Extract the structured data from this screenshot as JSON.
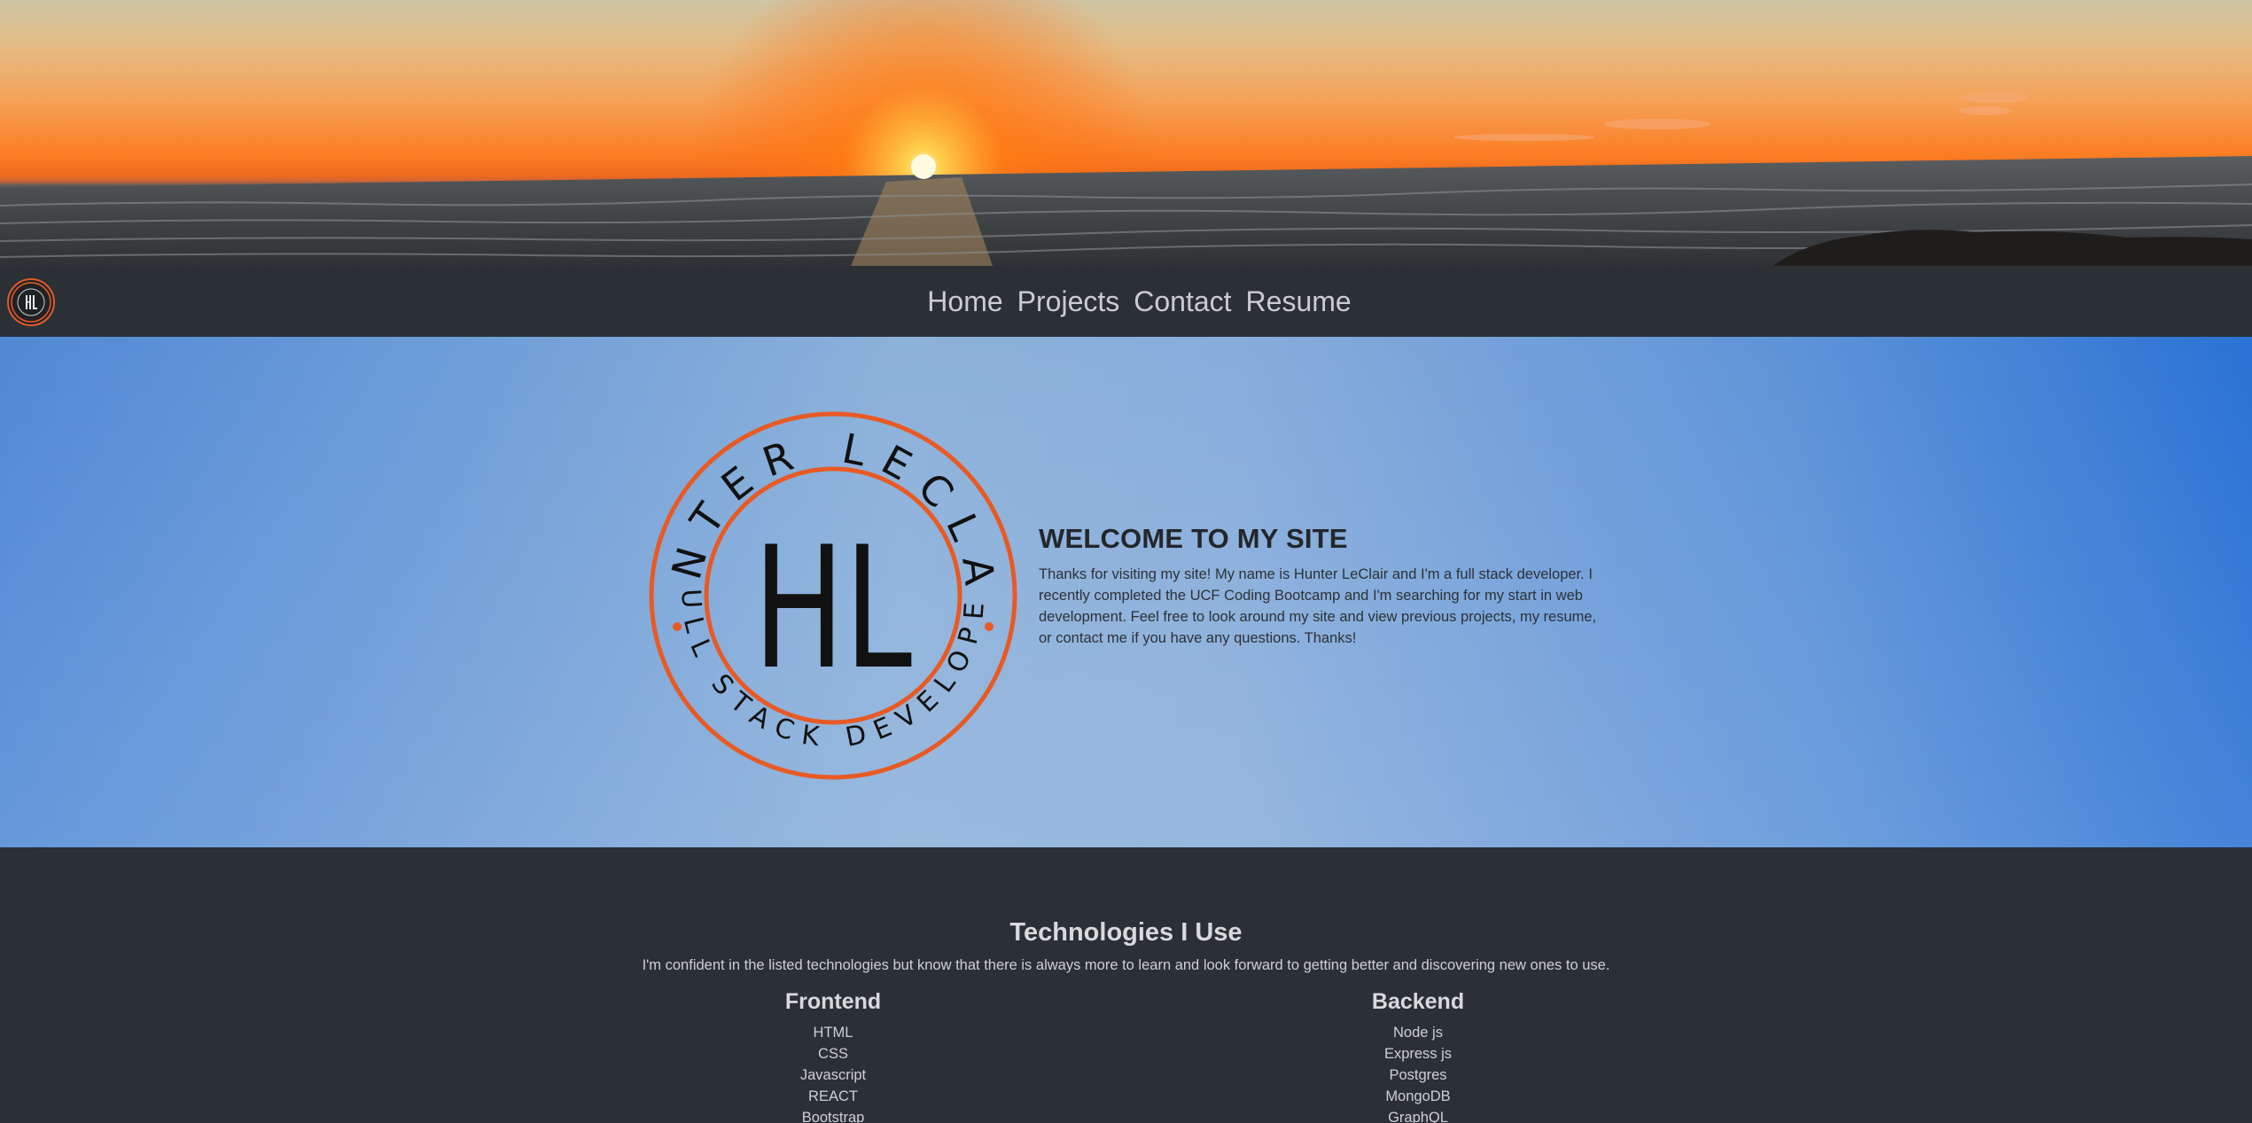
{
  "banner": {
    "alt": "Sunset over the ocean"
  },
  "nav": {
    "logo_icon": "hl-monogram-icon",
    "links": [
      "Home",
      "Projects",
      "Contact",
      "Resume"
    ]
  },
  "hero": {
    "logo": {
      "top_arc": "HUNTER LECLAIR",
      "bottom_arc": "FULL STACK DEVELOPER",
      "monogram": "HL"
    },
    "title": "WELCOME TO MY SITE",
    "body": "Thanks for visiting my site! My name is Hunter LeClair and I'm a full stack developer. I recently completed the UCF Coding Bootcamp and I'm searching for my start in web development. Feel free to look around my site and view previous projects, my resume, or contact me if you have any questions. Thanks!"
  },
  "tech": {
    "title": "Technologies I Use",
    "intro": "I'm confident in the listed technologies but know that there is always more to learn and look forward to getting better and discovering new ones to use.",
    "frontend": {
      "title": "Frontend",
      "items": [
        "HTML",
        "CSS",
        "Javascript",
        "REACT",
        "Bootstrap"
      ]
    },
    "backend": {
      "title": "Backend",
      "items": [
        "Node js",
        "Express js",
        "Postgres",
        "MongoDB",
        "GraphQL"
      ]
    }
  },
  "colors": {
    "navbar": "#2b3035",
    "accent": "#e85a24",
    "hero_blue": "#6d9dd8"
  }
}
